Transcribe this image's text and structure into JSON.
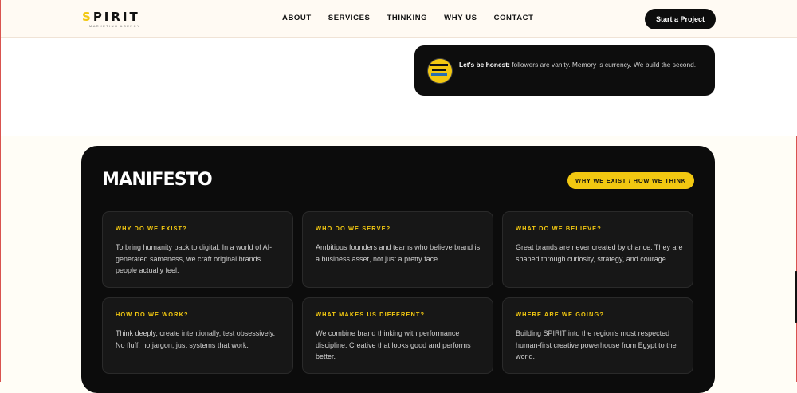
{
  "brand": {
    "name": "SPIRIT",
    "first_letter": "S",
    "rest": "PIRIT",
    "tagline": "MARKETING AGENCY"
  },
  "nav": {
    "items": [
      "ABOUT",
      "SERVICES",
      "THINKING",
      "WHY US",
      "CONTACT"
    ],
    "cta": "Start a Project"
  },
  "quote": {
    "lead": "Let's be honest:",
    "body": " followers are vanity. Memory is currency. We build the second."
  },
  "manifesto": {
    "title": "MANIFESTO",
    "badge": "WHY WE EXIST / HOW WE THINK",
    "cards": [
      {
        "q": "WHY DO WE EXIST?",
        "a": "To bring humanity back to digital. In a world of AI-generated sameness, we craft original brands people actually feel."
      },
      {
        "q": "WHO DO WE SERVE?",
        "a": "Ambitious founders and teams who believe brand is a business asset, not just a pretty face."
      },
      {
        "q": "WHAT DO WE BELIEVE?",
        "a": "Great brands are never created by chance. They are shaped through curiosity, strategy, and courage."
      },
      {
        "q": "HOW DO WE WORK?",
        "a": "Think deeply, create intentionally, test obsessively. No fluff, no jargon, just systems that work."
      },
      {
        "q": "WHAT MAKES US DIFFERENT?",
        "a": "We combine brand thinking with performance discipline. Creative that looks good and performs better."
      },
      {
        "q": "WHERE ARE WE GOING?",
        "a": "Building SPIRIT into the region's most respected human-first creative powerhouse from Egypt to the world."
      }
    ]
  },
  "colors": {
    "accent": "#f2c811",
    "panel": "#0c0c0c",
    "card": "#171717"
  }
}
